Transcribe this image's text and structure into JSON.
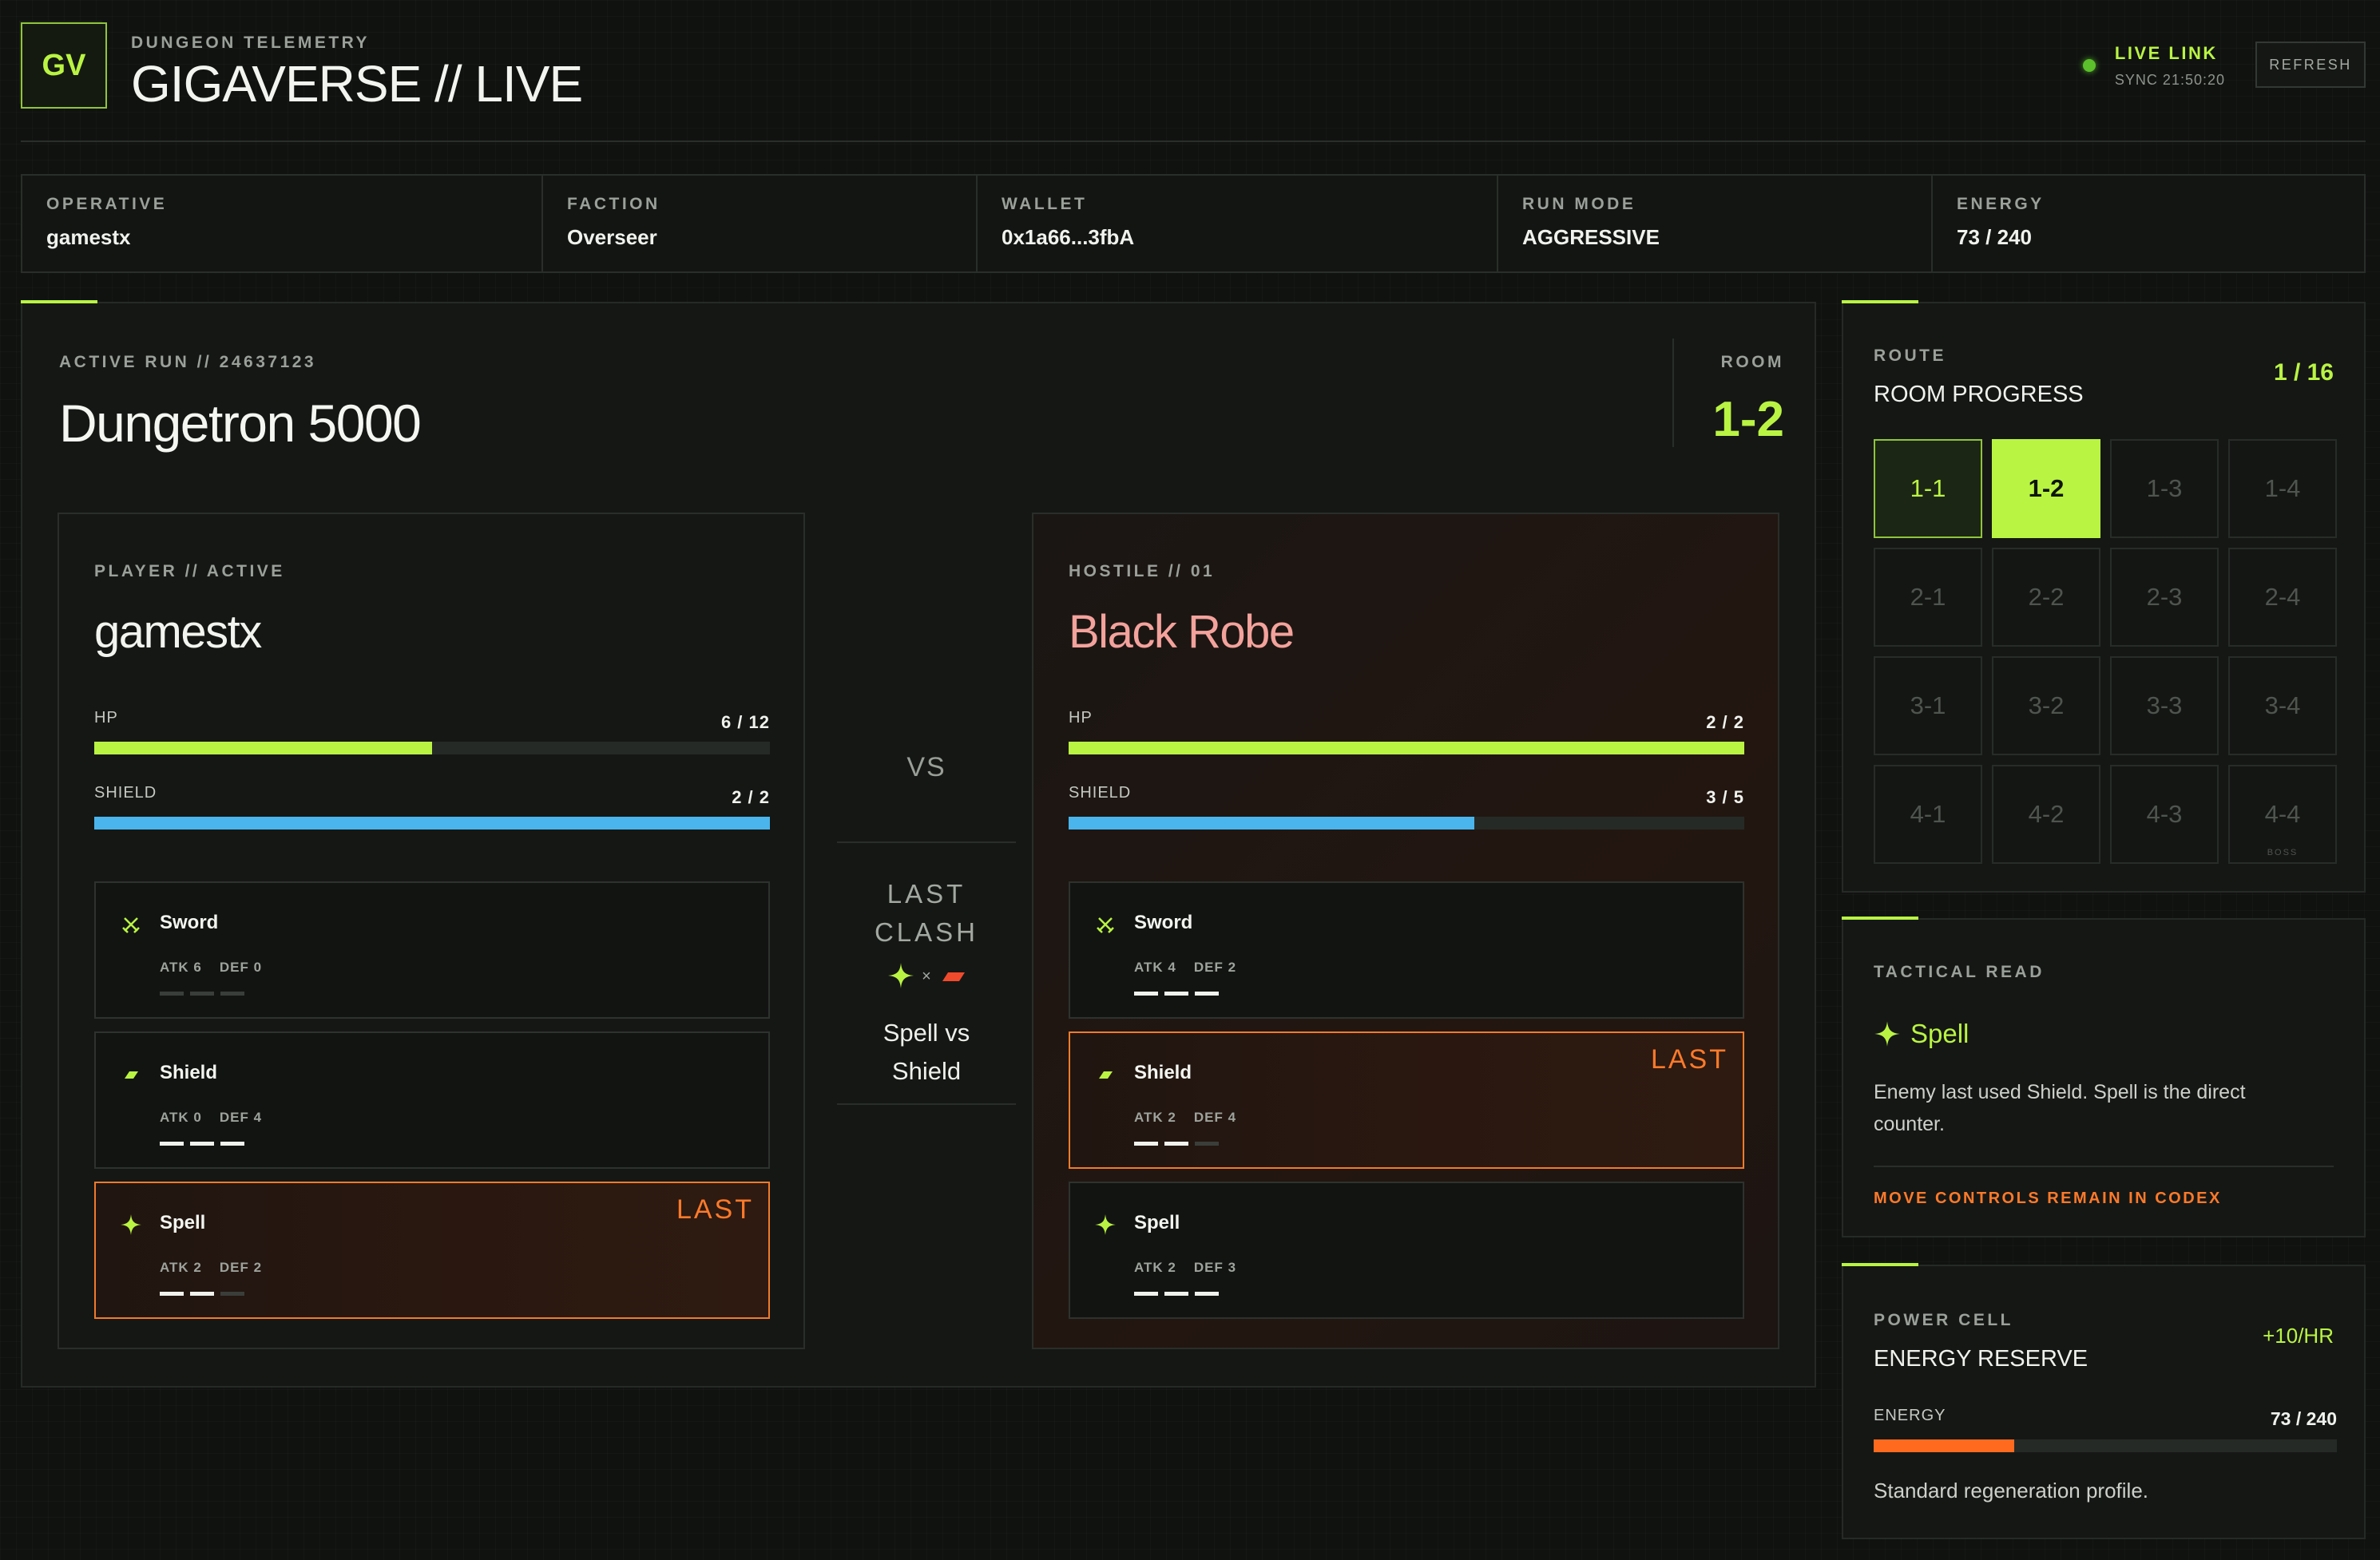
{
  "header": {
    "logo": "GV",
    "subtitle": "DUNGEON TELEMETRY",
    "title": "GIGAVERSE // LIVE",
    "live_label": "LIVE LINK",
    "sync": "SYNC 21:50:20",
    "refresh_label": "REFRESH"
  },
  "info": [
    {
      "label": "OPERATIVE",
      "value": "gamestx"
    },
    {
      "label": "FACTION",
      "value": "Overseer"
    },
    {
      "label": "WALLET",
      "value": "0x1a66...3fbA"
    },
    {
      "label": "RUN MODE",
      "value": "AGGRESSIVE"
    },
    {
      "label": "ENERGY",
      "value": "73 / 240"
    }
  ],
  "run": {
    "subtitle": "ACTIVE RUN // 24637123",
    "title": "Dungetron 5000",
    "room_label": "ROOM",
    "room_value": "1-2"
  },
  "player": {
    "subtitle": "PLAYER // ACTIVE",
    "name": "gamestx",
    "hp_label": "HP",
    "hp_text": "6 / 12",
    "hp_fraction": 0.5,
    "shield_label": "SHIELD",
    "shield_text": "2 / 2",
    "shield_fraction": 1.0,
    "moves": [
      {
        "name": "Sword",
        "atk": "ATK 6",
        "def": "DEF 0",
        "charges": 0,
        "last": ""
      },
      {
        "name": "Shield",
        "atk": "ATK 0",
        "def": "DEF 4",
        "charges": 3,
        "last": ""
      },
      {
        "name": "Spell",
        "atk": "ATK 2",
        "def": "DEF 2",
        "charges": 2,
        "last": "LAST"
      }
    ]
  },
  "enemy": {
    "subtitle": "HOSTILE // 01",
    "name": "Black Robe",
    "hp_label": "HP",
    "hp_text": "2 / 2",
    "hp_fraction": 1.0,
    "shield_label": "SHIELD",
    "shield_text": "3 / 5",
    "shield_fraction": 0.6,
    "moves": [
      {
        "name": "Sword",
        "atk": "ATK 4",
        "def": "DEF 2",
        "charges": 3,
        "last": ""
      },
      {
        "name": "Shield",
        "atk": "ATK 2",
        "def": "DEF 4",
        "charges": 2,
        "last": "LAST"
      },
      {
        "name": "Spell",
        "atk": "ATK 2",
        "def": "DEF 3",
        "charges": 3,
        "last": ""
      }
    ]
  },
  "clash": {
    "vs": "VS",
    "label_line1": "LAST",
    "label_line2": "CLASH",
    "result_line1": "Spell vs",
    "result_line2": "Shield",
    "times": "×"
  },
  "route": {
    "label": "ROUTE",
    "title": "ROOM PROGRESS",
    "progress": "1 / 16",
    "rooms": [
      "1-1",
      "1-2",
      "1-3",
      "1-4",
      "2-1",
      "2-2",
      "2-3",
      "2-4",
      "3-1",
      "3-2",
      "3-3",
      "3-4",
      "4-1",
      "4-2",
      "4-3",
      "4-4"
    ],
    "completed": [
      "1-1"
    ],
    "current": "1-2",
    "boss_label": "BOSS"
  },
  "tactical": {
    "label": "TACTICAL READ",
    "move": "Spell",
    "text": "Enemy last used Shield. Spell is the direct counter.",
    "note": "MOVE CONTROLS REMAIN IN CODEX"
  },
  "power": {
    "label": "POWER CELL",
    "title": "ENERGY RESERVE",
    "rate": "+10/HR",
    "energy_label": "ENERGY",
    "energy_text": "73 / 240",
    "energy_fraction": 0.304,
    "note": "Standard regeneration profile."
  },
  "colors": {
    "accent": "#b9f443",
    "shield": "#4ab5ec",
    "warning": "#ff7a2a",
    "enemy_name": "#f3a29c"
  }
}
